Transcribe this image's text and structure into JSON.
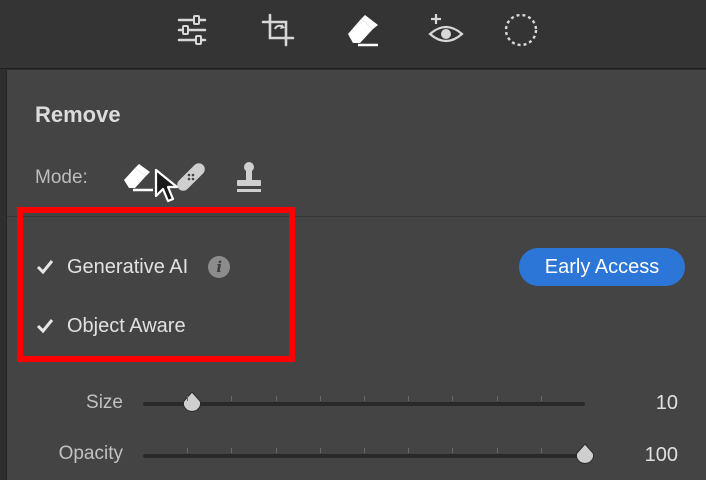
{
  "toolbar": {
    "tools": [
      {
        "icon": "adjustments-sliders-icon",
        "active": false
      },
      {
        "icon": "crop-icon",
        "active": false
      },
      {
        "icon": "eraser-icon",
        "active": true
      },
      {
        "icon": "red-eye-icon",
        "active": false
      },
      {
        "icon": "masking-circle-icon",
        "active": false
      }
    ]
  },
  "panel": {
    "title": "Remove",
    "mode_label": "Mode:",
    "modes": [
      {
        "icon": "remove-eraser-icon",
        "selected": true
      },
      {
        "icon": "heal-bandage-icon",
        "selected": false
      },
      {
        "icon": "clone-stamp-icon",
        "selected": false
      }
    ],
    "options": [
      {
        "label": "Generative AI",
        "checked": true
      },
      {
        "label": "Object Aware",
        "checked": true
      }
    ],
    "info_glyph": "i",
    "early_access_label": "Early Access",
    "sliders": [
      {
        "label": "Size",
        "value": "10",
        "fraction": 0.11
      },
      {
        "label": "Opacity",
        "value": "100",
        "fraction": 1.0
      }
    ]
  },
  "colors": {
    "accent": "#2b76d6",
    "highlight": "#ff0000",
    "panel_bg": "#444444"
  }
}
